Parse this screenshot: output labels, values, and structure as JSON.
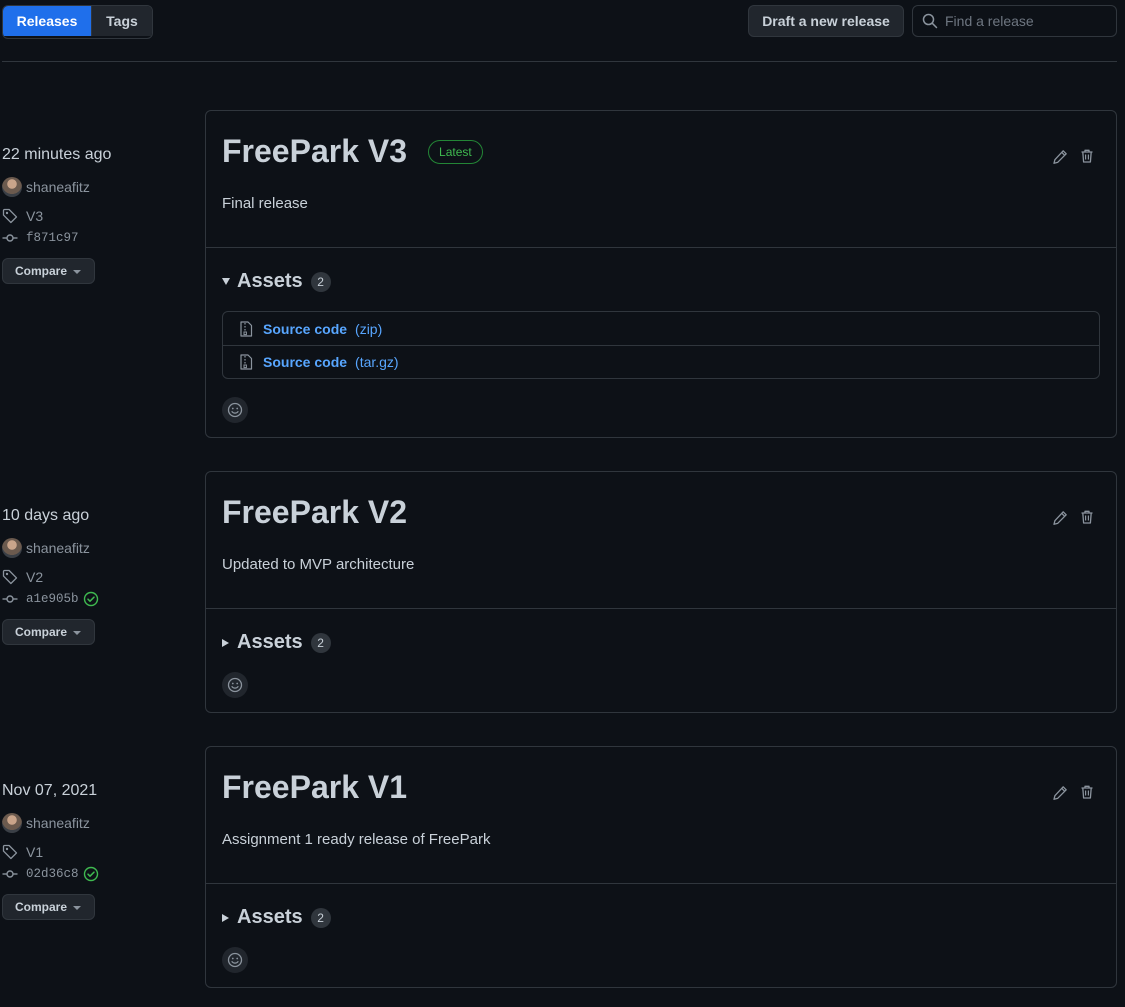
{
  "toolbar": {
    "tabs": [
      {
        "label": "Releases",
        "active": true
      },
      {
        "label": "Tags",
        "active": false
      }
    ],
    "draft_label": "Draft a new release",
    "search_placeholder": "Find a release"
  },
  "colors": {
    "accent": "#1f6feb",
    "link": "#58a6ff",
    "latest": "#3fb950",
    "background": "#0d1117",
    "border": "#30363d"
  },
  "releases": [
    {
      "date": "22 minutes ago",
      "author": "shaneafitz",
      "tag": "V3",
      "commit": "f871c97",
      "verified": false,
      "compare_label": "Compare",
      "title": "FreePark V3",
      "latest_label": "Latest",
      "description": "Final release",
      "assets_label": "Assets",
      "assets_count": "2",
      "assets_expanded": true,
      "assets": [
        {
          "name": "Source code",
          "ext": "(zip)",
          "icon": "file-zip-icon"
        },
        {
          "name": "Source code",
          "ext": "(tar.gz)",
          "icon": "file-zip-icon"
        }
      ]
    },
    {
      "date": "10 days ago",
      "author": "shaneafitz",
      "tag": "V2",
      "commit": "a1e905b",
      "verified": true,
      "compare_label": "Compare",
      "title": "FreePark V2",
      "description": "Updated to MVP architecture",
      "assets_label": "Assets",
      "assets_count": "2",
      "assets_expanded": false
    },
    {
      "date": "Nov 07, 2021",
      "author": "shaneafitz",
      "tag": "V1",
      "commit": "02d36c8",
      "verified": true,
      "compare_label": "Compare",
      "title": "FreePark V1",
      "description": "Assignment 1 ready release of FreePark",
      "assets_label": "Assets",
      "assets_count": "2",
      "assets_expanded": false
    }
  ]
}
